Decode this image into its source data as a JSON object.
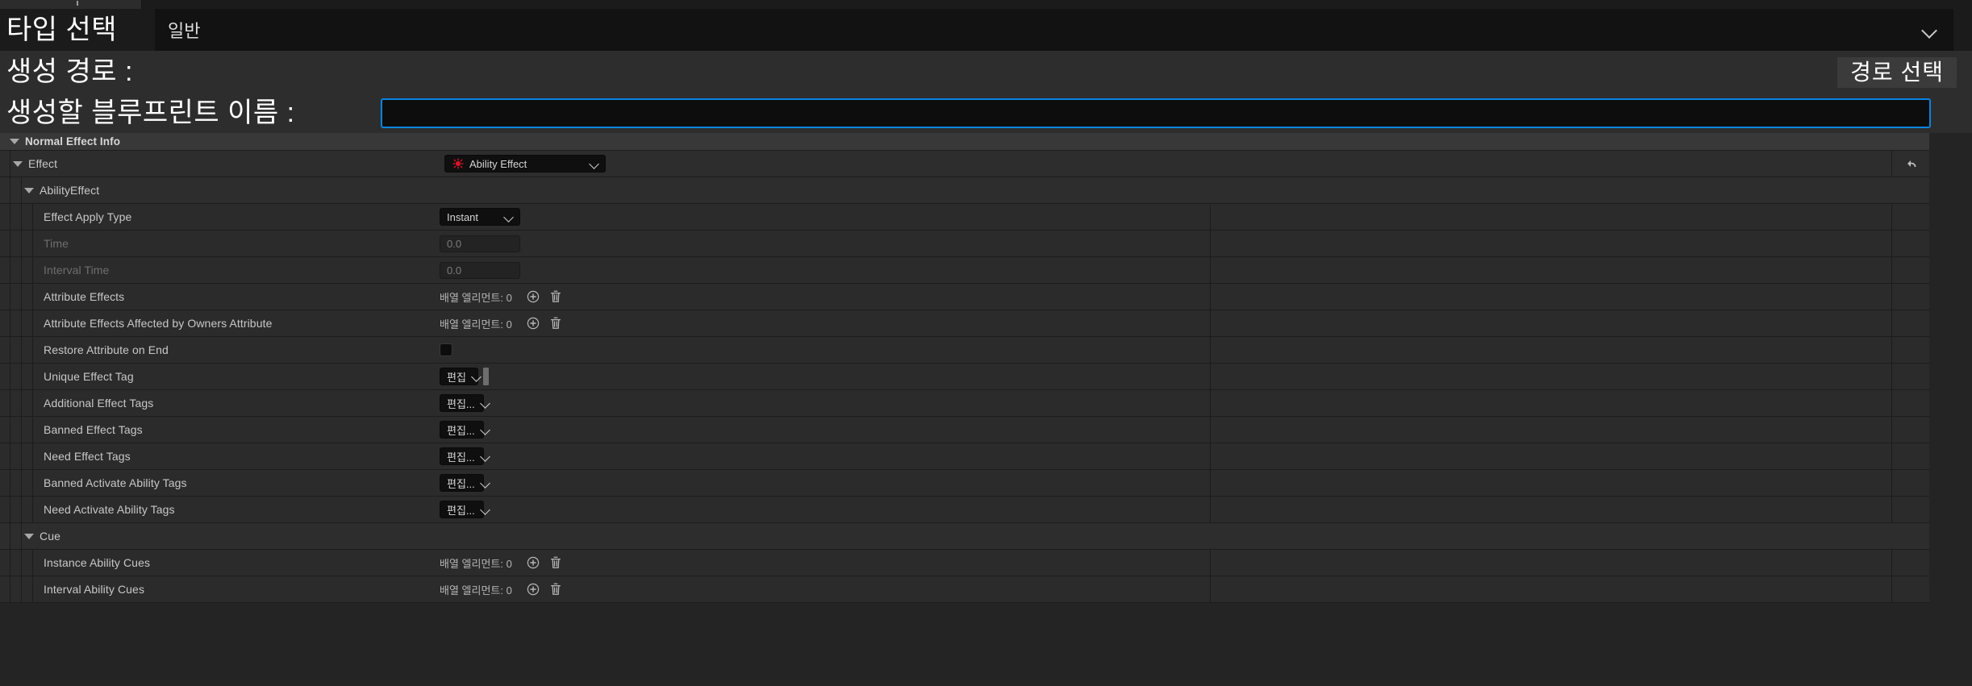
{
  "window": {
    "tab_marker": "tab-handle"
  },
  "header": {
    "type_select": {
      "label": "타입 선택",
      "value": "일반",
      "chevron_icon": "chevron-down-icon"
    },
    "create_path": {
      "label": "생성 경로 :",
      "button_label": "경로 선택"
    },
    "blueprint_name": {
      "label": "생성할 블루프린트 이름 :",
      "value": "",
      "placeholder": ""
    }
  },
  "details": {
    "category": {
      "label": "Normal Effect Info",
      "expander_icon": "triangle-down-icon"
    },
    "effect_group": {
      "label": "Effect",
      "expander_icon": "triangle-down-icon",
      "combo_value": "Ability Effect",
      "combo_icon": "ability-effect-burst-icon",
      "chevron_icon": "chevron-down-icon",
      "reset_icon": "reset-arrow-icon",
      "accent_color": "#d4152a"
    },
    "ability_effect_group": {
      "label": "AbilityEffect",
      "expander_icon": "triangle-down-icon"
    },
    "cue_group": {
      "label": "Cue",
      "expander_icon": "triangle-down-icon"
    },
    "rows": [
      {
        "label": "Effect Apply Type",
        "widget": "combo",
        "value": "Instant",
        "disabled": false
      },
      {
        "label": "Time",
        "widget": "number",
        "value": "0.0",
        "disabled": true
      },
      {
        "label": "Interval Time",
        "widget": "number",
        "value": "0.0",
        "disabled": true
      },
      {
        "label": "Attribute Effects",
        "widget": "array",
        "value": "배열 엘리먼트: 0",
        "disabled": false
      },
      {
        "label": "Attribute Effects Affected by Owners Attribute",
        "widget": "array",
        "value": "배열 엘리먼트: 0",
        "disabled": false
      },
      {
        "label": "Restore Attribute on End",
        "widget": "checkbox",
        "value": "",
        "checked": false,
        "disabled": false
      },
      {
        "label": "Unique Effect Tag",
        "widget": "tag-edit-stub",
        "value": "편집",
        "disabled": false
      },
      {
        "label": "Additional Effect Tags",
        "widget": "tag-edit",
        "value": "편집...",
        "disabled": false
      },
      {
        "label": "Banned Effect Tags",
        "widget": "tag-edit",
        "value": "편집...",
        "disabled": false
      },
      {
        "label": "Need Effect Tags",
        "widget": "tag-edit",
        "value": "편집...",
        "disabled": false
      },
      {
        "label": "Banned Activate Ability Tags",
        "widget": "tag-edit",
        "value": "편집...",
        "disabled": false
      },
      {
        "label": "Need Activate Ability Tags",
        "widget": "tag-edit",
        "value": "편집...",
        "disabled": false
      }
    ],
    "cue_rows": [
      {
        "label": "Instance Ability Cues",
        "widget": "array",
        "value": "배열 엘리먼트: 0"
      },
      {
        "label": "Interval Ability Cues",
        "widget": "array",
        "value": "배열 엘리먼트: 0"
      }
    ],
    "icons": {
      "add": "plus-circle-icon",
      "delete": "trash-icon"
    }
  },
  "colors": {
    "window_bg": "#242424",
    "header_bg": "#1b1b1b",
    "row_bg": "#2b2b2b",
    "category_bg": "#383838",
    "group_bg": "#2d2d2d",
    "focus_border": "#0a84e0",
    "text": "#c8c8c8",
    "text_disabled": "#6e6e6e"
  }
}
